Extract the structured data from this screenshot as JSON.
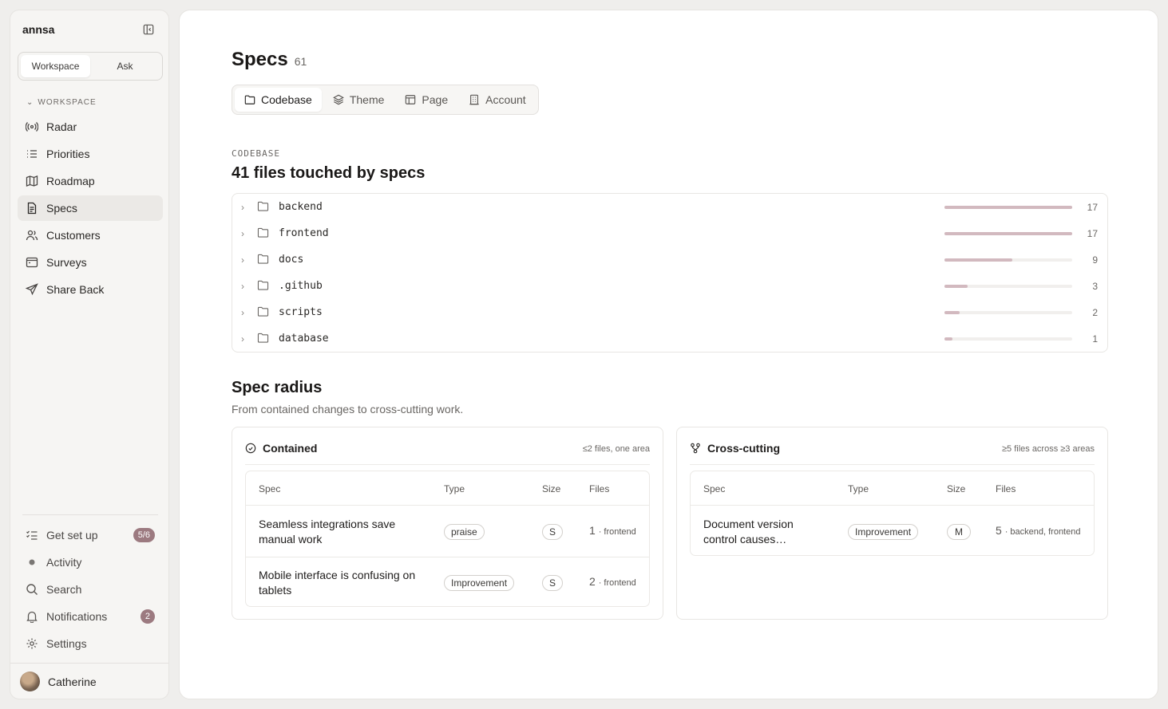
{
  "sidebar": {
    "brand": "annsa",
    "segments": [
      "Workspace",
      "Ask"
    ],
    "section": "WORKSPACE",
    "items": [
      {
        "label": "Radar",
        "icon": "radar-icon"
      },
      {
        "label": "Priorities",
        "icon": "list-icon"
      },
      {
        "label": "Roadmap",
        "icon": "map-icon"
      },
      {
        "label": "Specs",
        "icon": "document-icon",
        "active": true
      },
      {
        "label": "Customers",
        "icon": "users-icon"
      },
      {
        "label": "Surveys",
        "icon": "survey-icon"
      },
      {
        "label": "Share Back",
        "icon": "send-icon"
      }
    ],
    "bottom": [
      {
        "label": "Get set up",
        "badge": "5/6"
      },
      {
        "label": "Activity"
      },
      {
        "label": "Search"
      },
      {
        "label": "Notifications",
        "badge": "2"
      },
      {
        "label": "Settings"
      }
    ],
    "user": "Catherine"
  },
  "header": {
    "title": "Specs",
    "count": "61"
  },
  "tabs": [
    "Codebase",
    "Theme",
    "Page",
    "Account"
  ],
  "codebase": {
    "eyebrow": "CODEBASE",
    "title": "41 files touched by specs",
    "folders": [
      {
        "name": "backend",
        "count": "17",
        "share": 1.0
      },
      {
        "name": "frontend",
        "count": "17",
        "share": 1.0
      },
      {
        "name": "docs",
        "count": "9",
        "share": 0.53
      },
      {
        "name": ".github",
        "count": "3",
        "share": 0.18
      },
      {
        "name": "scripts",
        "count": "2",
        "share": 0.12
      },
      {
        "name": "database",
        "count": "1",
        "share": 0.06
      }
    ]
  },
  "radius": {
    "title": "Spec radius",
    "subtitle": "From contained changes to cross-cutting work.",
    "columns": [
      "Spec",
      "Type",
      "Size",
      "Files"
    ],
    "contained": {
      "title": "Contained",
      "note": "≤2 files, one area",
      "rows": [
        {
          "spec": "Seamless integrations save manual work",
          "type": "praise",
          "size": "S",
          "files": "1",
          "area": "· frontend"
        },
        {
          "spec": "Mobile interface is confusing on tablets",
          "type": "Improvement",
          "size": "S",
          "files": "2",
          "area": "· frontend"
        }
      ]
    },
    "cross": {
      "title": "Cross-cutting",
      "note": "≥5 files across ≥3 areas",
      "rows": [
        {
          "spec": "Document version control causes…",
          "type": "Improvement",
          "size": "M",
          "files": "5",
          "area": "· backend, frontend"
        }
      ]
    }
  }
}
